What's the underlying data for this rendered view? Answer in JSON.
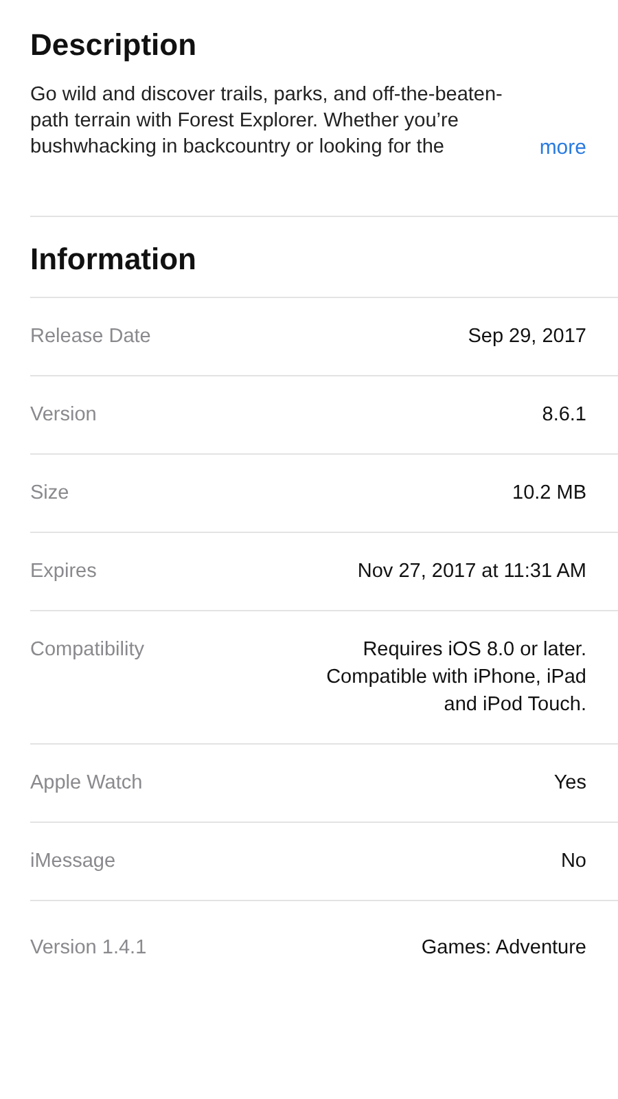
{
  "description": {
    "heading": "Description",
    "text": "Go wild and discover trails, parks, and off-the-beaten-path terrain with Forest Explorer. Whether you’re bushwhacking in backcountry or looking for the",
    "more": "more"
  },
  "information": {
    "heading": "Information",
    "rows": [
      {
        "label": "Release Date",
        "value": "Sep 29, 2017"
      },
      {
        "label": "Version",
        "value": "8.6.1"
      },
      {
        "label": "Size",
        "value": "10.2 MB"
      },
      {
        "label": "Expires",
        "value": "Nov 27, 2017 at 11:31 AM"
      },
      {
        "label": "Compatibility",
        "value": "Requires iOS 8.0 or later. Compatible with iPhone, iPad and iPod Touch."
      },
      {
        "label": "Apple Watch",
        "value": "Yes"
      },
      {
        "label": "iMessage",
        "value": "No"
      },
      {
        "label": "Version 1.4.1",
        "value": "Games: Adventure"
      }
    ]
  }
}
